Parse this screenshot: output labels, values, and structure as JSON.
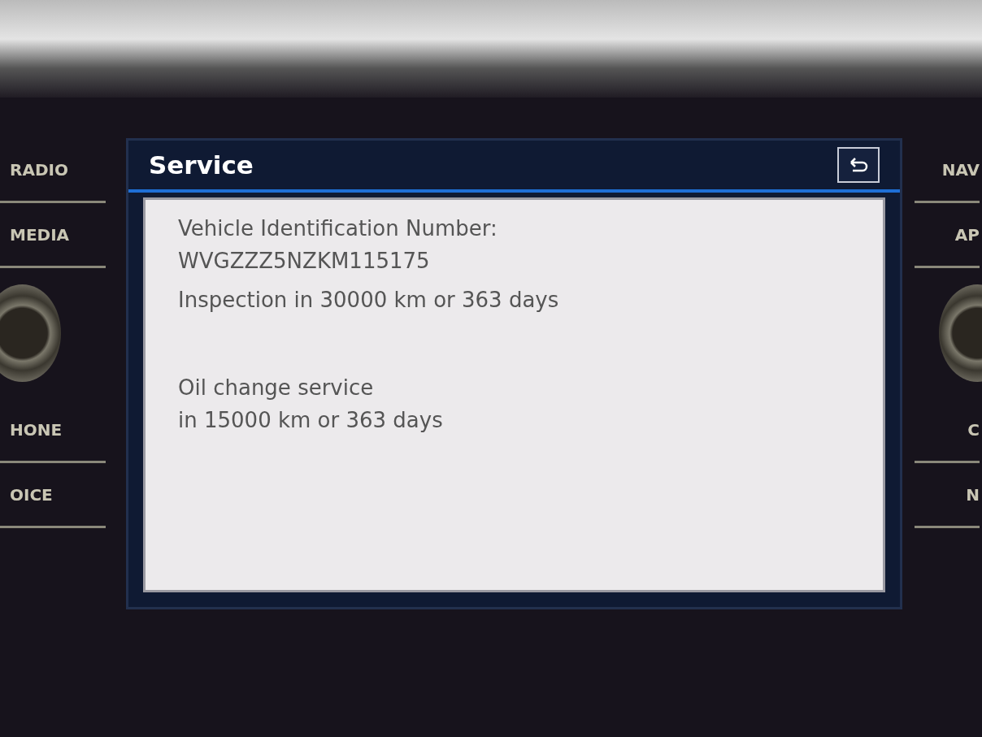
{
  "left_buttons": [
    {
      "label": "RADIO"
    },
    {
      "label": "MEDIA"
    },
    {
      "label": "HONE"
    },
    {
      "label": "OICE"
    }
  ],
  "right_buttons": [
    {
      "label": "NAV"
    },
    {
      "label": "AP"
    },
    {
      "label": "C"
    },
    {
      "label": "N"
    }
  ],
  "screen": {
    "title": "Service",
    "paragraphs": [
      [
        "Vehicle Identification Number:",
        "WVGZZZ5NZKM115175"
      ],
      [
        "Inspection in 30000 km or 363 days"
      ],
      [
        "Oil change service",
        "in 15000 km or 363 days"
      ]
    ]
  }
}
